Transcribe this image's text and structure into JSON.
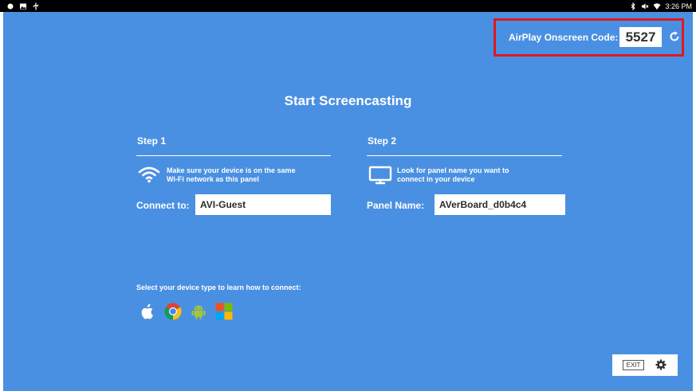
{
  "status_bar": {
    "left_icons": [
      "notification-dot-icon",
      "image-icon",
      "usb-icon"
    ],
    "right_icons": [
      "bluetooth-icon",
      "mute-icon",
      "wifi-icon"
    ],
    "time": "3:26 PM"
  },
  "airplay": {
    "label": "AirPlay Onscreen Code:",
    "code": "5527",
    "refresh_icon": "refresh-icon",
    "highlight_color": "#e0191b"
  },
  "title": "Start Screencasting",
  "step1": {
    "title": "Step 1",
    "icon": "wifi-icon",
    "description_line1": "Make sure your device is on the same",
    "description_line2": "Wi-Fi network as this panel",
    "field_label": "Connect to:",
    "field_value": "AVI-Guest"
  },
  "step2": {
    "title": "Step 2",
    "icon": "monitor-icon",
    "description_line1": "Look for panel name you want to",
    "description_line2": "connect in your device",
    "field_label": "Panel Name:",
    "field_value": "AVerBoard_d0b4c4"
  },
  "device_prompt": "Select your device type to learn how to connect:",
  "device_types": [
    {
      "name": "apple",
      "icon": "apple-icon"
    },
    {
      "name": "chrome",
      "icon": "chrome-icon"
    },
    {
      "name": "android",
      "icon": "android-icon"
    },
    {
      "name": "windows",
      "icon": "windows-icon"
    }
  ],
  "exit_label": "EXIT",
  "settings_icon": "gear-icon",
  "colors": {
    "background": "#4a90e2",
    "highlight": "#e0191b",
    "text": "#ffffff"
  }
}
